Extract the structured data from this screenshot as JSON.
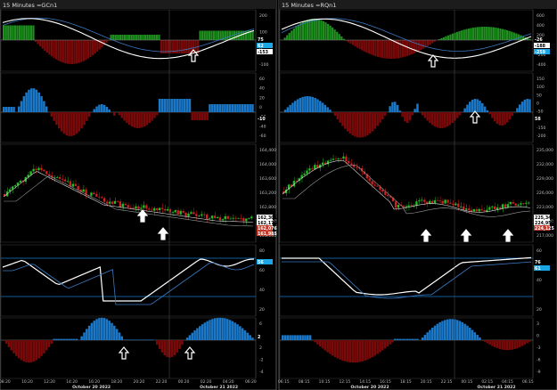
{
  "left": {
    "title": "15 Minutes =GCn1",
    "p1_axis": [
      "200",
      "100",
      "0",
      "-100"
    ],
    "p1_badges": [
      {
        "v": "75",
        "c": "#000000",
        "fg": "#ffffff"
      },
      {
        "v": "62",
        "c": "#1ba6e6",
        "fg": "#ffffff"
      },
      {
        "v": "-153",
        "c": "#ffffff",
        "fg": "#000000"
      }
    ],
    "p2_axis": [
      "60",
      "40",
      "20",
      "0",
      "-20",
      "-40",
      "-60"
    ],
    "p2_badges": [
      {
        "v": "-10",
        "c": "#000000",
        "fg": "#ffffff"
      }
    ],
    "p3_axis": [
      "164,400",
      "164,000",
      "163,600",
      "163,200",
      "162,800",
      "162,400",
      "161,600"
    ],
    "p3_badges": [
      {
        "v": "162,301",
        "c": "#ffffff",
        "fg": "#000000"
      },
      {
        "v": "162,175",
        "c": "#ffffff",
        "fg": "#000000"
      },
      {
        "v": "162,076",
        "c": "#c0392b",
        "fg": "#ffffff"
      },
      {
        "v": "161,985",
        "c": "#c0392b",
        "fg": "#ffffff"
      }
    ],
    "p4_axis": [
      "80",
      "60",
      "40",
      "20"
    ],
    "p4_badges": [
      {
        "v": "56",
        "c": "#1ba6e6",
        "fg": "#ffffff"
      }
    ],
    "p5_axis": [
      "6",
      "4",
      "2",
      "-2",
      "-4"
    ],
    "p5_badges": [
      {
        "v": "2",
        "c": "#000000",
        "fg": "#ffffff"
      }
    ],
    "time_labels": [
      "08:20",
      "10:20",
      "12:20",
      "14:20",
      "16:20",
      "18:20",
      "20:20",
      "22:20",
      "00:20",
      "02:20",
      "04:20",
      "06:20"
    ],
    "date_labels": [
      "October 20 2022",
      "October 21 2022"
    ]
  },
  "right": {
    "title": "15 Minutes =RQn1",
    "p1_axis": [
      "600",
      "400",
      "200",
      "0",
      "-200",
      "-400"
    ],
    "p1_badges": [
      {
        "v": "-26",
        "c": "#000000",
        "fg": "#ffffff"
      },
      {
        "v": "-188",
        "c": "#ffffff",
        "fg": "#000000"
      },
      {
        "v": "-259",
        "c": "#1ba6e6",
        "fg": "#ffffff"
      }
    ],
    "p2_axis": [
      "150",
      "100",
      "50",
      "0",
      "-50",
      "-100",
      "-150",
      "-200"
    ],
    "p2_badges": [
      {
        "v": "58",
        "c": "#000000",
        "fg": "#ffffff"
      }
    ],
    "p3_axis": [
      "235,000",
      "232,000",
      "229,000",
      "226,000",
      "223,000",
      "220,000",
      "217,000"
    ],
    "p3_badges": [
      {
        "v": "225,340",
        "c": "#ffffff",
        "fg": "#000000"
      },
      {
        "v": "224,950",
        "c": "#ffffff",
        "fg": "#000000"
      },
      {
        "v": "224,125",
        "c": "#c0392b",
        "fg": "#ffffff"
      }
    ],
    "p4_axis": [
      "60",
      "40",
      "20"
    ],
    "p4_badges": [
      {
        "v": "76",
        "c": "#000000",
        "fg": "#ffffff"
      },
      {
        "v": "61",
        "c": "#1ba6e6",
        "fg": "#ffffff"
      }
    ],
    "p5_axis": [
      "3",
      "0",
      "-3",
      "-6",
      "-9"
    ],
    "p5_badges": [],
    "time_labels": [
      "06:15",
      "08:15",
      "10:15",
      "12:15",
      "14:15",
      "16:15",
      "18:15",
      "20:15",
      "22:15",
      "00:15",
      "02:15",
      "04:15",
      "06:15"
    ],
    "date_labels": [
      "October 20 2022",
      "October 21 2022"
    ]
  },
  "colors": {
    "bg": "#000000",
    "green": "#1f8f1f",
    "red": "#7a0a0a",
    "blue": "#1b78c8",
    "white": "#ffffff",
    "grid": "#3a3a3a",
    "candle_up": "#22c022",
    "candle_dn": "#d02020"
  }
}
